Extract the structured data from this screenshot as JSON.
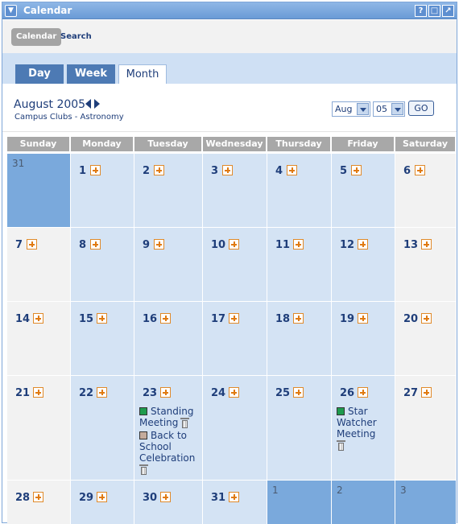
{
  "window": {
    "title": "Calendar"
  },
  "toolbar": {
    "calendar_label": "Calendar",
    "search_label": "Search"
  },
  "tabs": [
    {
      "label": "Day",
      "active": false
    },
    {
      "label": "Week",
      "active": false
    },
    {
      "label": "Month",
      "active": true
    }
  ],
  "header": {
    "month_title": "August 2005",
    "subtitle": "Campus Clubs - Astronomy",
    "month_select": "Aug",
    "day_select": "05",
    "go_label": "GO"
  },
  "weekdays": [
    "Sunday",
    "Monday",
    "Tuesday",
    "Wednesday",
    "Thursday",
    "Friday",
    "Saturday"
  ],
  "weeks": [
    [
      {
        "day": "31",
        "other": true
      },
      {
        "day": "1"
      },
      {
        "day": "2"
      },
      {
        "day": "3"
      },
      {
        "day": "4"
      },
      {
        "day": "5"
      },
      {
        "day": "6"
      }
    ],
    [
      {
        "day": "7"
      },
      {
        "day": "8"
      },
      {
        "day": "9"
      },
      {
        "day": "10"
      },
      {
        "day": "11"
      },
      {
        "day": "12"
      },
      {
        "day": "13"
      }
    ],
    [
      {
        "day": "14"
      },
      {
        "day": "15"
      },
      {
        "day": "16"
      },
      {
        "day": "17"
      },
      {
        "day": "18"
      },
      {
        "day": "19"
      },
      {
        "day": "20"
      }
    ],
    [
      {
        "day": "21"
      },
      {
        "day": "22"
      },
      {
        "day": "23",
        "events": [
          {
            "lines": [
              "Standing",
              "Meeting"
            ],
            "color": "#1e9b4e"
          },
          {
            "lines": [
              "Back to",
              "School",
              "Celebration"
            ],
            "color": "#c4ab9c"
          }
        ]
      },
      {
        "day": "24"
      },
      {
        "day": "25"
      },
      {
        "day": "26",
        "events": [
          {
            "lines": [
              "Star",
              "Watcher",
              "Meeting"
            ],
            "color": "#1e9b4e"
          }
        ]
      },
      {
        "day": "27"
      }
    ],
    [
      {
        "day": "28"
      },
      {
        "day": "29"
      },
      {
        "day": "30"
      },
      {
        "day": "31"
      },
      {
        "day": "1",
        "other": true
      },
      {
        "day": "2",
        "other": true
      },
      {
        "day": "3",
        "other": true
      }
    ]
  ],
  "colors": {
    "titlebar": "#7aa8e0",
    "weekday_cell": "#d4e3f4",
    "weekend_cell": "#f2f2f2",
    "other_month_cell": "#7aa9dc"
  }
}
